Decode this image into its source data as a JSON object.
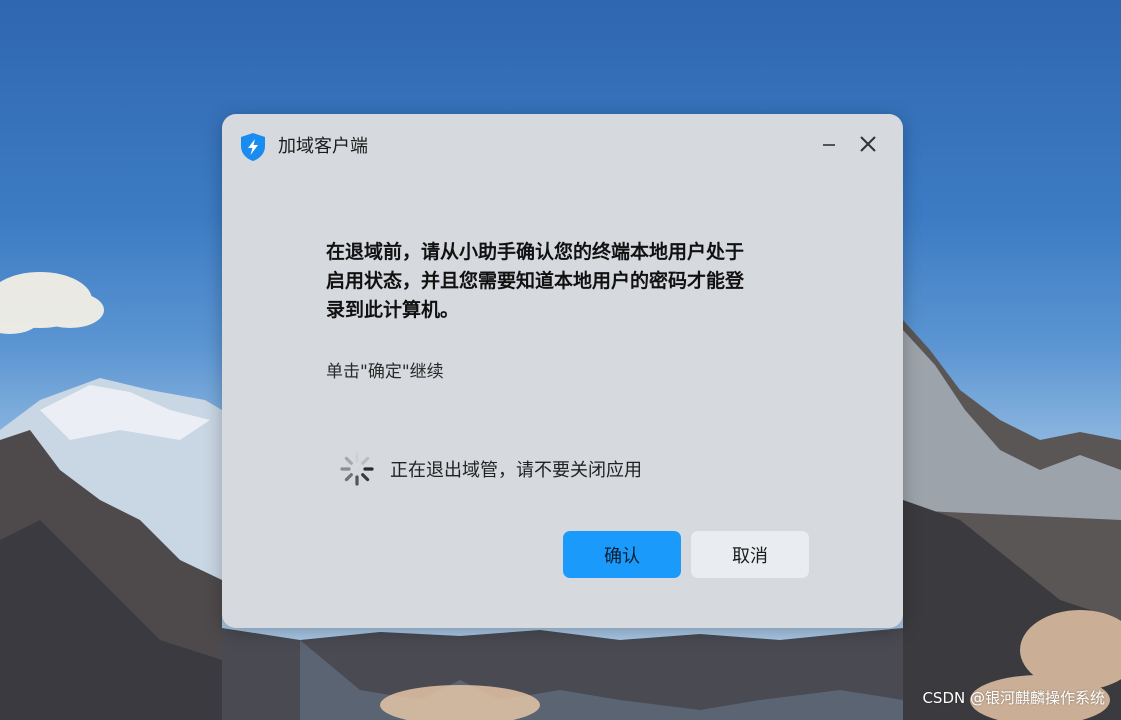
{
  "dialog": {
    "title": "加域客户端",
    "app_icon": "shield-lightning-icon",
    "minimize_icon": "minimize-icon",
    "close_icon": "close-icon",
    "message_lines": [
      "在退域前，请从小助手确认您的终端本地用户处于",
      "启用状态，并且您需要知道本地用户的密码才能登",
      "录到此计算机。"
    ],
    "hint": "单击\"确定\"继续",
    "status": {
      "icon": "loading-spinner-icon",
      "text": "正在退出域管，请不要关闭应用"
    },
    "buttons": {
      "confirm_label": "确认",
      "cancel_label": "取消"
    }
  },
  "watermark": "CSDN @银河麒麟操作系统",
  "colors": {
    "accent": "#1a9bfb",
    "dialog_bg": "#d6d9de",
    "cancel_bg": "#e9ecf1"
  }
}
